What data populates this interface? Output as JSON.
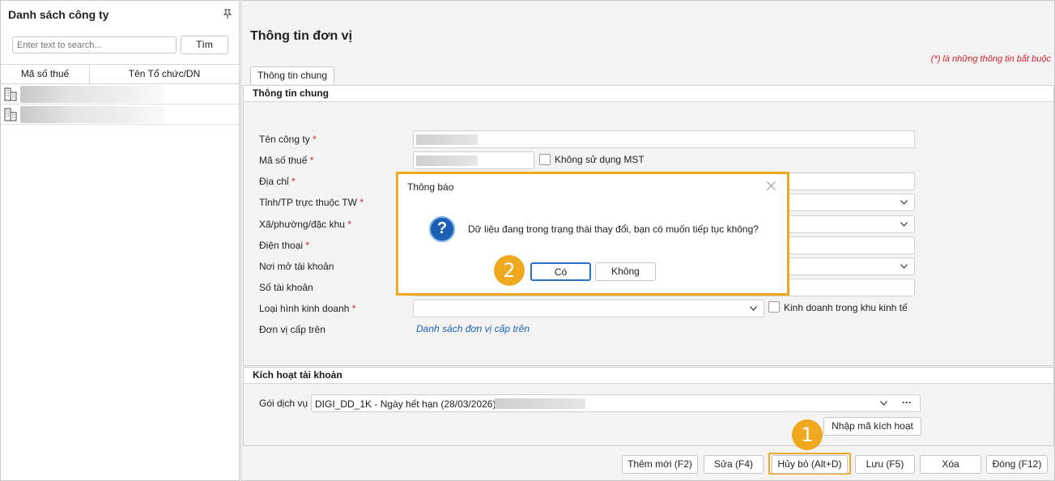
{
  "left_panel": {
    "title": "Danh sách công ty",
    "search_placeholder": "Enter text to search...",
    "search_button": "Tìm",
    "columns": [
      "Mã số thuế",
      "Tên Tổ chức/DN"
    ],
    "rows": [
      {
        "icon": "building-icon"
      },
      {
        "icon": "building-icon"
      }
    ]
  },
  "main": {
    "title": "Thông tin đơn vị",
    "required_note": "(*)  là những thông tin bắt buộc",
    "tab": "Thông tin chung",
    "section_general": "Thông tin chung",
    "fields": {
      "company_name": "Tên công ty",
      "tax_code": "Mã số thuế",
      "address": "Địa chỉ",
      "province": "Tỉnh/TP trực thuộc TW",
      "ward": "Xã/phường/đặc khu",
      "phone": "Điện thoại",
      "bank_branch": "Nơi mở tài khoản",
      "account_number": "Số tài khoản",
      "business_type": "Loại hình kinh doanh",
      "parent_unit": "Đơn vị cấp trên"
    },
    "required_star": "*",
    "no_tax_code_checkbox": "Không sử dụng MST",
    "econ_zone_checkbox": "Kinh doanh trong khu kinh tế",
    "parent_unit_link": "Danh sách đơn vị cấp trên",
    "section_activation": "Kích hoạt tài khoản",
    "service_package_label": "Gói dịch vụ",
    "service_package_value": "DIGI_DD_1K - Ngày hết hạn (28/03/2026) -",
    "more_button": "···",
    "enter_activation_code": "Nhập mã kích hoạt"
  },
  "footer": {
    "add_new": "Thêm mới (F2)",
    "edit": "Sửa (F4)",
    "cancel": "Hủy bỏ (Alt+D)",
    "save": "Lưu (F5)",
    "delete": "Xóa",
    "close": "Đóng (F12)"
  },
  "dialog": {
    "title": "Thông báo",
    "icon": "question-icon",
    "message": "Dữ liệu đang trong trạng thái thay đổi, bạn có muốn tiếp tục không?",
    "yes": "Có",
    "no": "Không"
  },
  "annotations": {
    "step1": "1",
    "step2": "2"
  },
  "colors": {
    "highlight": "#f0a81e",
    "required": "#d0202a",
    "link": "#1d61b5",
    "dialog_icon": "#1d5fb3"
  }
}
